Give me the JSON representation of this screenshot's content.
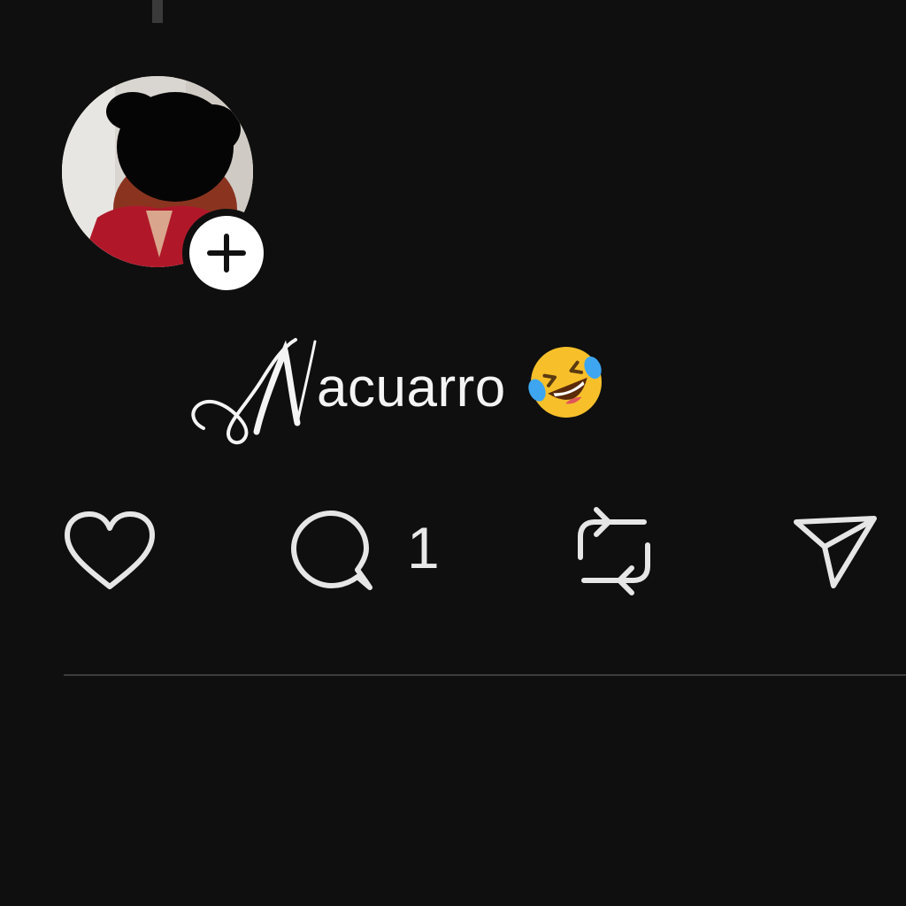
{
  "post": {
    "author_avatar_icon": "avatar-photo",
    "follow_icon": "plus-icon",
    "text_initial": "N",
    "text_rest": "acuarro",
    "emoji_icon": "rolling-on-the-floor-laughing-emoji"
  },
  "actions": {
    "like_icon": "heart-icon",
    "reply_icon": "comment-icon",
    "reply_count": "1",
    "repost_icon": "repost-icon",
    "share_icon": "send-icon"
  },
  "colors": {
    "background": "#0f0f0f",
    "text": "#f4f4f4",
    "icon": "#e6e6e6",
    "divider": "#3c3c3c"
  }
}
